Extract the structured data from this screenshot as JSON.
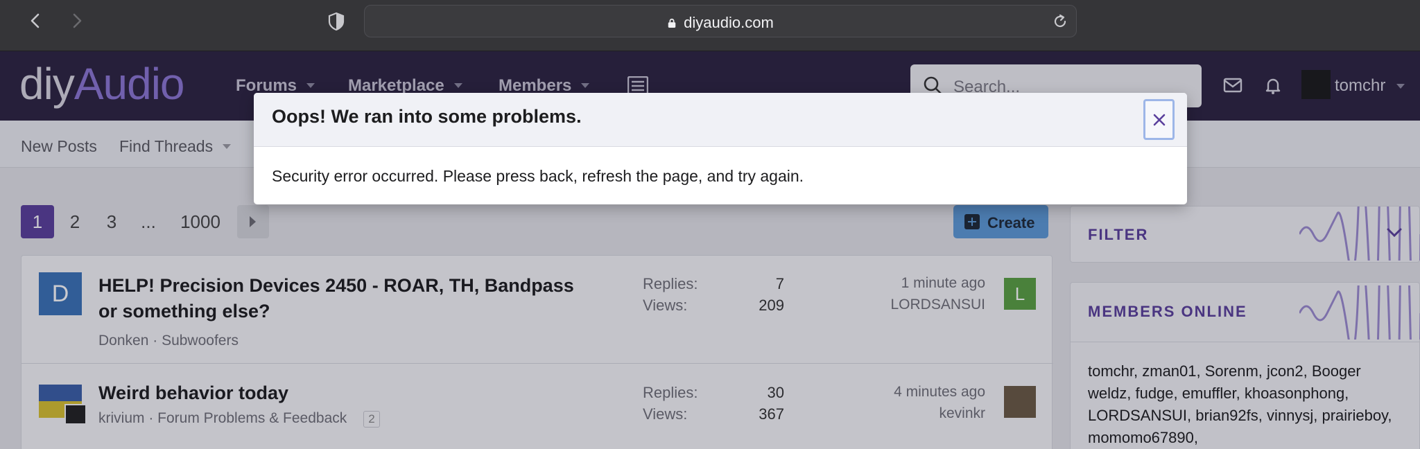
{
  "browser": {
    "url": "diyaudio.com"
  },
  "header": {
    "logo_part1": "diy",
    "logo_part2": "Audio",
    "nav": [
      "Forums",
      "Marketplace",
      "Members"
    ],
    "search_placeholder": "Search...",
    "username": "tomchr"
  },
  "subnav": [
    "New Posts",
    "Find Threads"
  ],
  "pagination": {
    "pages": [
      "1",
      "2",
      "3",
      "...",
      "1000"
    ],
    "current": "1"
  },
  "create_label": "Create",
  "threads": [
    {
      "avatar_letter": "D",
      "avatar_color": "#3a72b8",
      "title": "HELP! Precision Devices 2450 - ROAR, TH, Bandpass or something else?",
      "author": "Donken",
      "forum": "Subwoofers",
      "replies_label": "Replies:",
      "replies": "7",
      "views_label": "Views:",
      "views": "209",
      "last_time": "1 minute ago",
      "last_user": "LORDSANSUI",
      "last_avatar_letter": "L",
      "last_avatar_color": "#5aa042"
    },
    {
      "title": "Weird behavior today",
      "author": "krivium",
      "forum": "Forum Problems & Feedback",
      "pages_badge": "2",
      "replies_label": "Replies:",
      "replies": "30",
      "views_label": "Views:",
      "views": "367",
      "last_time": "4 minutes ago",
      "last_user": "kevinkr"
    }
  ],
  "sidebar": {
    "filter_title": "FILTER",
    "members_title": "MEMBERS ONLINE",
    "members_list": "tomchr, zman01, Sorenm, jcon2, Booger weldz, fudge, emuffler, khoasonphong, LORDSANSUI, brian92fs, vinnysj, prairieboy, momomo67890,"
  },
  "modal": {
    "title": "Oops! We ran into some problems.",
    "message": "Security error occurred. Please press back, refresh the page, and try again."
  },
  "colors": {
    "header_bg": "#2c2340",
    "accent": "#5a3f9c",
    "create_btn": "#5d9ad8"
  }
}
